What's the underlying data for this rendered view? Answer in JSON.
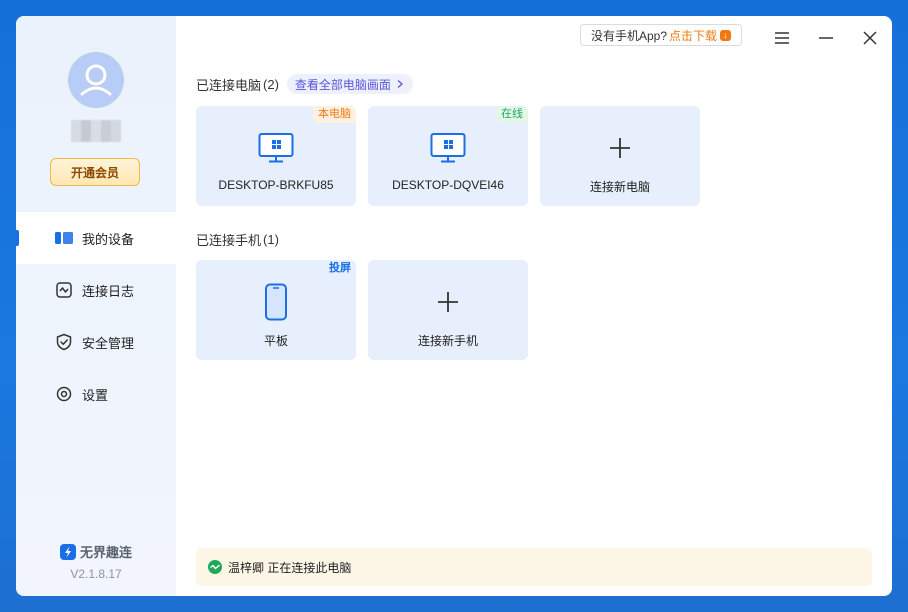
{
  "app": {
    "name": "无界趣连",
    "version": "V2.1.8.17"
  },
  "sidebar": {
    "vip_label": "开通会员",
    "items": [
      {
        "label": "我的设备",
        "icon": "devices-icon",
        "active": true
      },
      {
        "label": "连接日志",
        "icon": "log-icon",
        "active": false
      },
      {
        "label": "安全管理",
        "icon": "shield-icon",
        "active": false
      },
      {
        "label": "设置",
        "icon": "settings-icon",
        "active": false
      }
    ]
  },
  "topbar": {
    "promo_text": "没有手机App?",
    "promo_link": "点击下载"
  },
  "computers": {
    "title": "已连接电脑",
    "count": "(2)",
    "view_all": "查看全部电脑画面",
    "cards": [
      {
        "name": "DESKTOP-BRKFU85",
        "tag": "本电脑",
        "tag_color": "#ef7a1a"
      },
      {
        "name": "DESKTOP-DQVEI46",
        "tag": "在线",
        "tag_color": "#22a85a"
      }
    ],
    "add_label": "连接新电脑"
  },
  "phones": {
    "title": "已连接手机",
    "count": "(1)",
    "cards": [
      {
        "name": "平板",
        "tag": "投屏",
        "tag_color": "#1a6fe8"
      }
    ],
    "add_label": "连接新手机"
  },
  "status": {
    "text": "温梓卿 正在连接此电脑"
  },
  "colors": {
    "accent": "#1a6fe8",
    "card_bg": "#e6effb",
    "window_bg": "#1a78e0"
  }
}
